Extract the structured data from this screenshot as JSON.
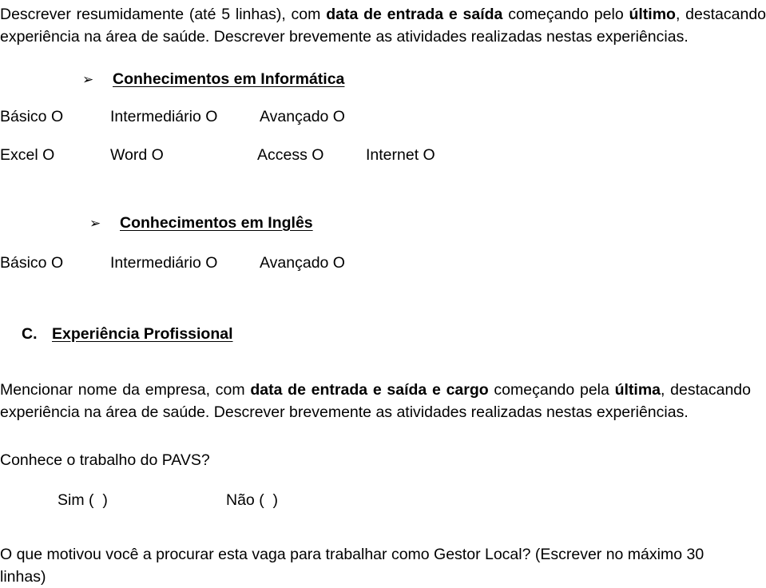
{
  "document": {
    "language": "pt-BR",
    "intro_paragraph": {
      "segments": [
        {
          "text": "Descrever resumidamente (até 5 linhas), com ",
          "bold": false
        },
        {
          "text": "data de entrada e saída",
          "bold": true
        },
        {
          "text": " começando pelo ",
          "bold": false
        },
        {
          "text": "último",
          "bold": true
        },
        {
          "text": ", destacando experiência na área de saúde. Descrever brevemente as atividades realizadas nestas experiências.",
          "bold": false
        }
      ],
      "plain": "Descrever resumidamente (até 5 linhas), com data de entrada e saída começando pelo último, destacando experiência na área de saúde. Descrever brevemente as atividades realizadas nestas experiências."
    },
    "informatica": {
      "bullet_glyph": "➢",
      "bullet_icon_name": "arrow-bullet-icon",
      "heading": "Conhecimentos em Informática",
      "level_options": [
        {
          "label": "Básico",
          "marker": "O"
        },
        {
          "label": "Intermediário",
          "marker": "O"
        },
        {
          "label": "Avançado",
          "marker": "O"
        }
      ],
      "software_options": [
        {
          "label": "Excel",
          "marker": "O"
        },
        {
          "label": "Word",
          "marker": "O"
        },
        {
          "label": "Access",
          "marker": "O"
        },
        {
          "label": "Internet",
          "marker": "O"
        }
      ]
    },
    "ingles": {
      "bullet_glyph": "➢",
      "bullet_icon_name": "arrow-bullet-icon",
      "heading": "Conhecimentos em Inglês",
      "level_options": [
        {
          "label": "Básico",
          "marker": "O"
        },
        {
          "label": "Intermediário",
          "marker": "O"
        },
        {
          "label": "Avançado",
          "marker": "O"
        }
      ]
    },
    "experiencia": {
      "letter": "C.",
      "title": "Experiência Profissional",
      "paragraph": {
        "segments": [
          {
            "text": "Mencionar nome da empresa, com ",
            "bold": false
          },
          {
            "text": "data de entrada e saída e cargo",
            "bold": true
          },
          {
            "text": " começando pela ",
            "bold": false
          },
          {
            "text": "última",
            "bold": true
          },
          {
            "text": ", destacando experiência na área de saúde. Descrever brevemente as atividades realizadas nestas experiências.",
            "bold": false
          }
        ],
        "plain": "Mencionar nome da empresa, com data de entrada e saída e cargo começando pela última, destacando experiência na área de saúde. Descrever brevemente as atividades realizadas nestas experiências."
      }
    },
    "pavs_question": {
      "question": "Conhece o trabalho do PAVS?",
      "yes_label": "Sim (  )",
      "no_label": "Não (  )"
    },
    "motivation_question": {
      "line1": "O que motivou você a procurar esta vaga para trabalhar como Gestor Local?  (Escrever no máximo 30",
      "line2": "linhas)",
      "plain": "O que motivou você a procurar esta vaga para trabalhar como Gestor Local? (Escrever no máximo 30 linhas)"
    }
  },
  "colors": {
    "page_background": "#ffffff",
    "text": "#000000"
  }
}
